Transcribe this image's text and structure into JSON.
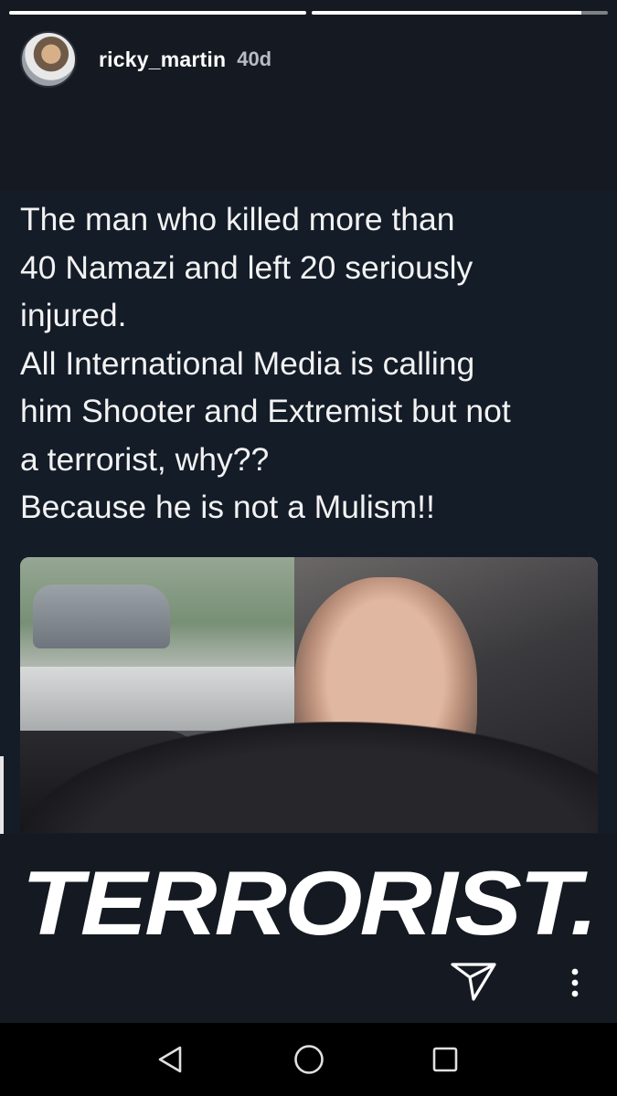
{
  "story": {
    "progress": [
      1.0,
      0.91
    ],
    "user": {
      "username": "ricky_martin",
      "age": "40d"
    },
    "post": {
      "lines": [
        "The man who killed more than",
        "40 Namazi and left 20 seriously",
        "injured.",
        "All International Media is calling",
        "him Shooter and Extremist but not",
        "a terrorist, why??",
        "Because he is not a Mulism!!"
      ]
    },
    "sticker": "TERRORIST.",
    "actions": {
      "send_icon": "send-icon",
      "more_icon": "more-options-icon"
    }
  },
  "navbar": {
    "back_icon": "back-icon",
    "home_icon": "home-icon",
    "recents_icon": "recents-icon"
  },
  "colors": {
    "background": "#151a22",
    "text": "#f2f2f2",
    "navbar": "#000000"
  }
}
